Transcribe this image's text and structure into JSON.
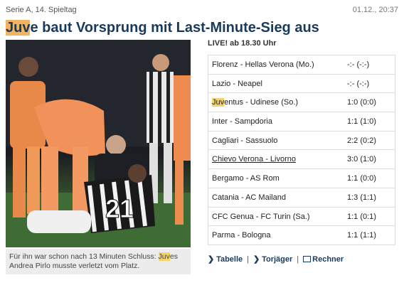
{
  "header": {
    "section": "Serie A, 14. Spieltag",
    "datetime": "01.12., 20:37"
  },
  "headline": {
    "highlight": "Juv",
    "rest": "e baut Vorsprung mit Last-Minute-Sieg aus"
  },
  "caption": {
    "line1_pre": "Für ihn war schon nach 13 Minuten Schluss: ",
    "line1_hl": "Juv",
    "line1_post": "es",
    "line2": "Andrea Pirlo musste verletzt vom Platz."
  },
  "live_label": "LIVE! ab 18.30 Uhr",
  "matches": [
    {
      "match": "Florenz - Hellas Verona (Mo.)",
      "score": "-:- (-:-)"
    },
    {
      "match": "Lazio - Neapel",
      "score": "-:- (-:-)"
    },
    {
      "match_hl": "Juv",
      "match": "entus - Udinese (So.)",
      "score": "1:0 (0:0)"
    },
    {
      "match": "Inter - Sampdoria",
      "score": "1:1 (1:0)"
    },
    {
      "match": "Cagliari - Sassuolo",
      "score": "2:2 (0:2)"
    },
    {
      "match": "Chievo Verona - Livorno",
      "score": "3:0 (1:0)"
    },
    {
      "match": "Bergamo - AS Rom",
      "score": "1:1 (0:0)"
    },
    {
      "match": "Catania - AC Mailand",
      "score": "1:3 (1:1)"
    },
    {
      "match": "CFC Genua - FC Turin (Sa.)",
      "score": "1:1 (0:1)"
    },
    {
      "match": "Parma - Bologna",
      "score": "1:1 (1:1)"
    }
  ],
  "links": {
    "table": "Tabelle",
    "scorers": "Torjäger",
    "calculator": "Rechner"
  },
  "icons": [
    "chevron-right-icon",
    "calculator-icon"
  ],
  "colors": {
    "headline": "#1a3a5c",
    "highlight": "#f3b35f"
  }
}
